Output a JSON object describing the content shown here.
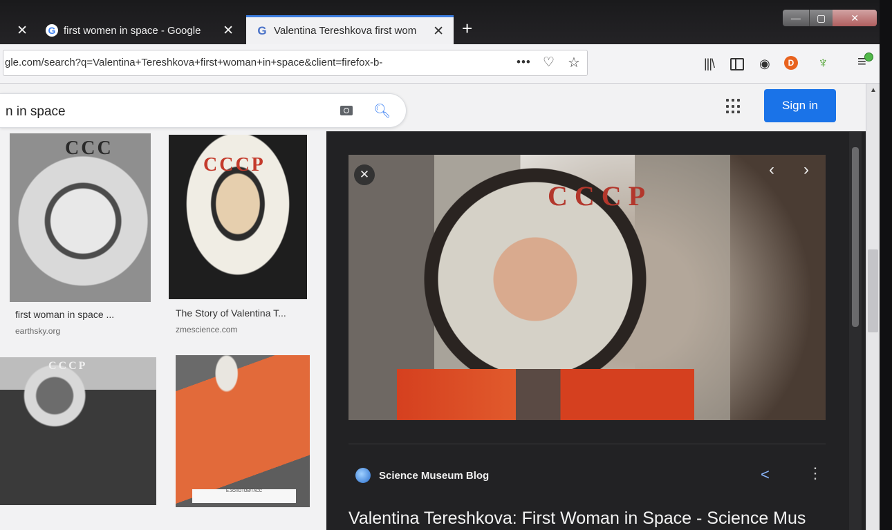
{
  "tabs": [
    {
      "title": "",
      "close": "✕"
    },
    {
      "title": "first women in space - Google",
      "close": "✕",
      "favicon": "G"
    },
    {
      "title": "Valentina Tereshkova first wom",
      "close": "✕",
      "favicon": "G"
    }
  ],
  "newtab": "+",
  "window_controls": {
    "minimize": "—",
    "maximize": "▢",
    "close": "✕"
  },
  "url": "gle.com/search?q=Valentina+Tereshkova+first+woman+in+space&client=firefox-b-",
  "url_actions": {
    "more": "•••",
    "pocket": "♡",
    "bookmark": "☆"
  },
  "toolbar_icons": {
    "library": "|||\\",
    "account": "◉",
    "ublock": "D",
    "extension": "♆",
    "menu": "≡"
  },
  "search": {
    "query": "n in space"
  },
  "header": {
    "signin": "Sign in"
  },
  "results": [
    {
      "title": "first woman in space ...",
      "source": "earthsky.org",
      "cccp": "CCC"
    },
    {
      "title": "The Story of Valentina T...",
      "source": "zmescience.com",
      "cccp": "CCCP"
    },
    {
      "title": "",
      "source": "",
      "cccp": "CCCP"
    },
    {
      "title": "",
      "source": "",
      "stamp": "Б.ЗОЛОТОВ/ТАСС"
    }
  ],
  "preview": {
    "cccp": "CCCP",
    "close": "✕",
    "prev": "‹",
    "next": "›",
    "site": "Science Museum Blog",
    "title": "Valentina Tereshkova: First Woman in Space - Science Mus",
    "share": "<",
    "more": "⋮"
  },
  "colors": {
    "accent": "#1a73e8",
    "tab_highlight": "#3b7de0",
    "preview_bg": "#222224"
  }
}
